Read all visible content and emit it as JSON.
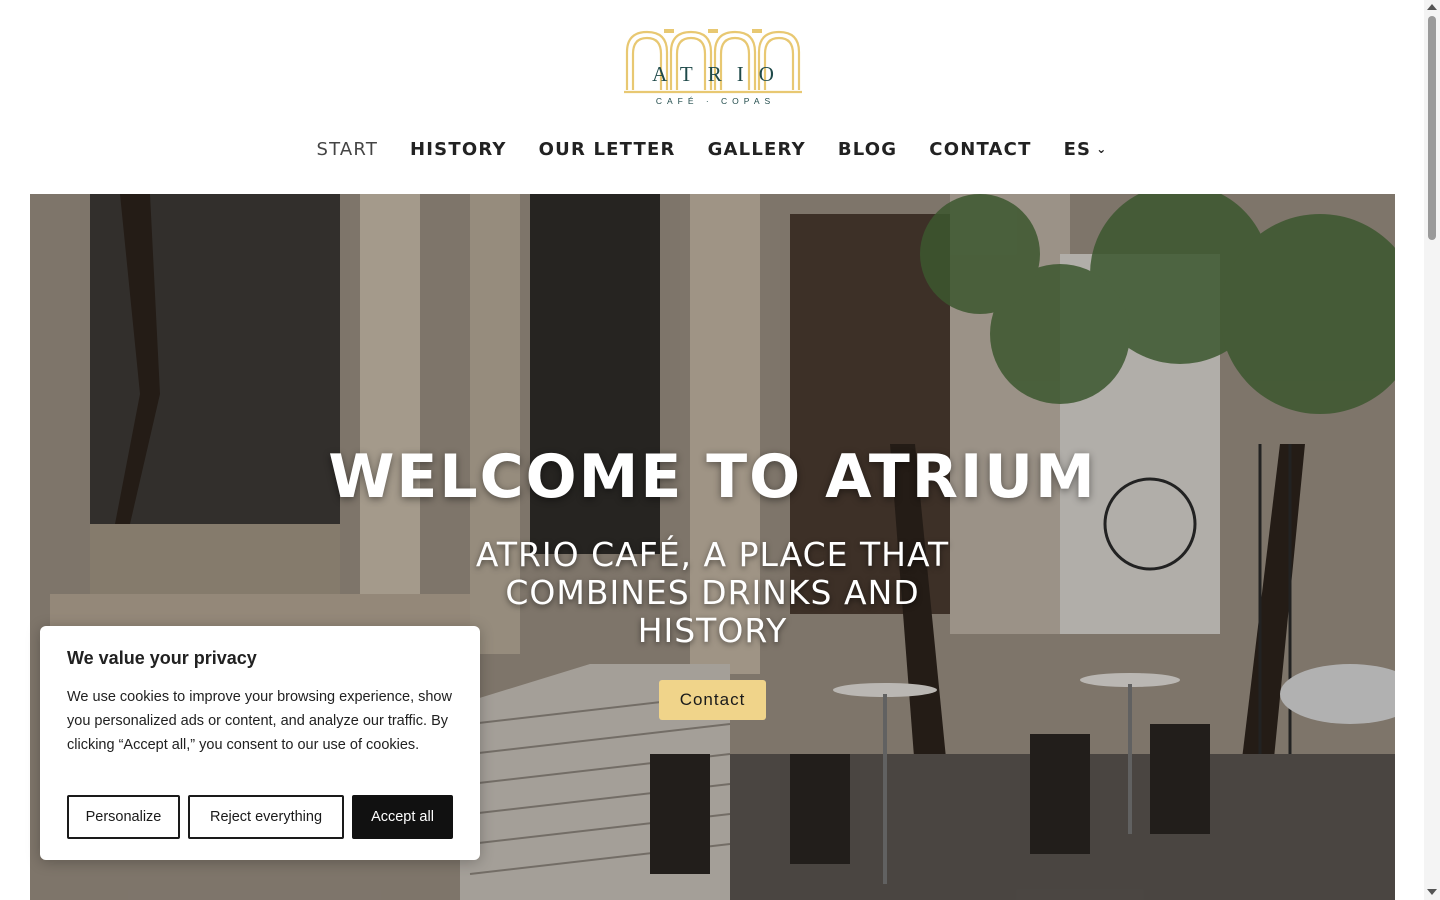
{
  "brand": {
    "wordmark": "ATRIO",
    "tagline": "CAFÉ · COPAS",
    "gold": "#e8c872",
    "teal": "#1f4a4a"
  },
  "nav": {
    "items": [
      {
        "label": "START",
        "active": true
      },
      {
        "label": "HISTORY"
      },
      {
        "label": "OUR LETTER"
      },
      {
        "label": "GALLERY"
      },
      {
        "label": "BLOG"
      },
      {
        "label": "CONTACT"
      }
    ],
    "language": "ES",
    "language_icon": "chevron-down-icon"
  },
  "hero": {
    "title": "WELCOME TO ATRIUM",
    "subtitle": "ATRIO CAFÉ, A PLACE THAT COMBINES DRINKS AND HISTORY",
    "button": "Contact",
    "button_color": "#f0d48a"
  },
  "cookie": {
    "title": "We value your privacy",
    "text": "We use cookies to improve your browsing experience, show you personalized ads or content, and analyze our traffic. By clicking “Accept all,” you consent to our use of cookies.",
    "personalize": "Personalize",
    "reject": "Reject everything",
    "accept": "Accept all"
  }
}
